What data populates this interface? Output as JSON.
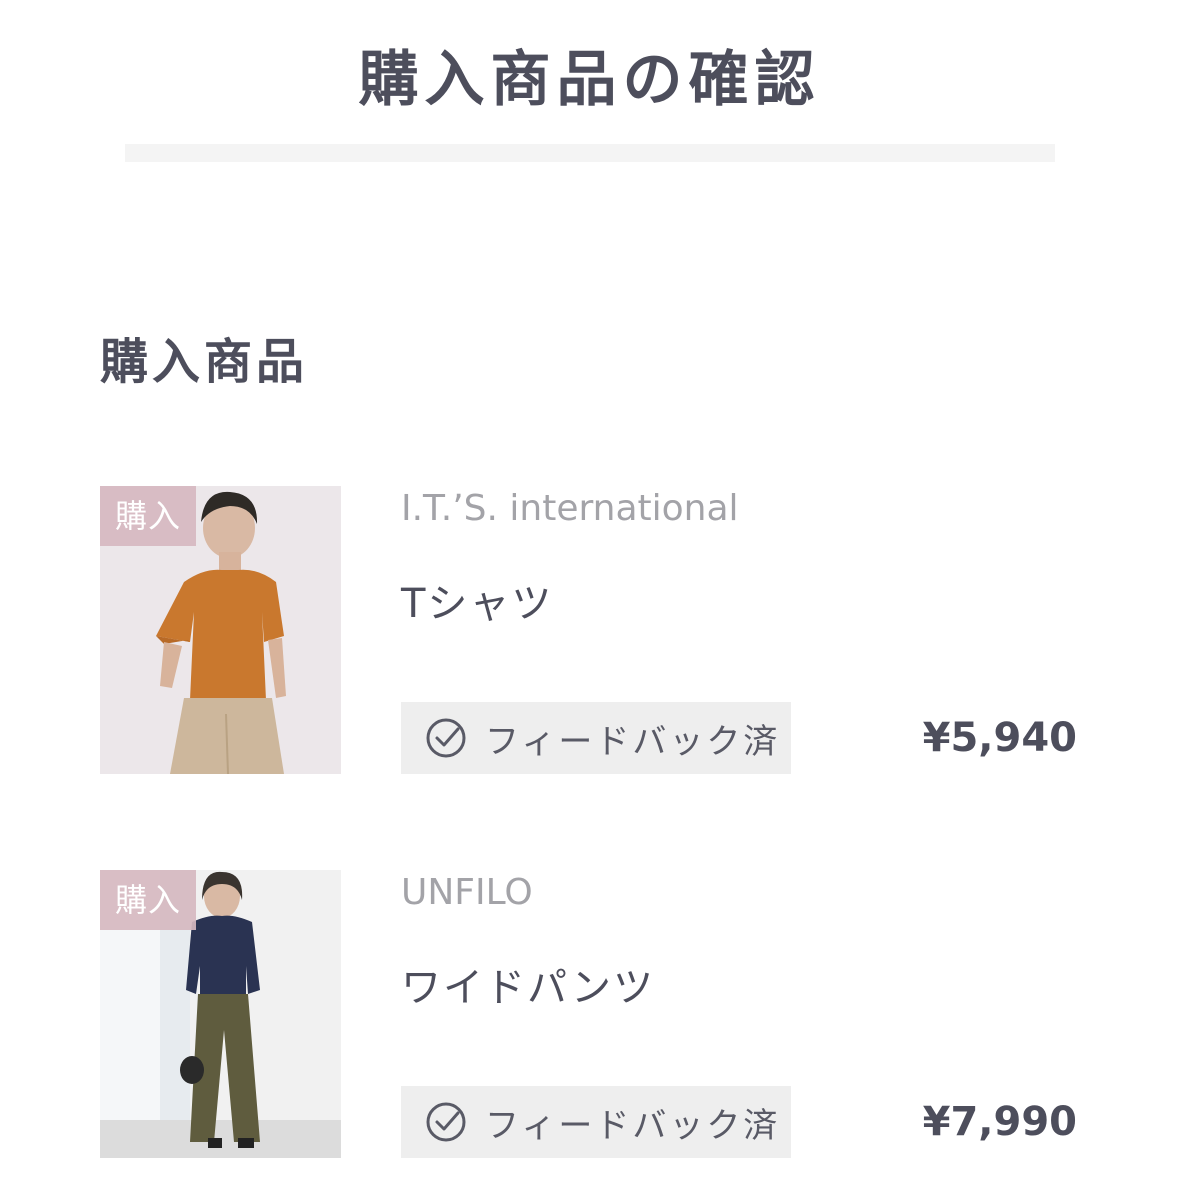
{
  "page": {
    "title": "購入商品の確認"
  },
  "section": {
    "title": "購入商品"
  },
  "products": [
    {
      "badge": "購入",
      "brand": "I.T.’S. international",
      "name": "Tシャツ",
      "feedback_label": "フィードバック済",
      "price": "¥5,940",
      "feedback_icon": "check-circle-icon"
    },
    {
      "badge": "購入",
      "brand": "UNFILO",
      "name": "ワイドパンツ",
      "feedback_label": "フィードバック済",
      "price": "¥7,990",
      "feedback_icon": "check-circle-icon"
    }
  ],
  "colors": {
    "text_dark": "#4d4e5c",
    "text_muted": "#a3a3a8",
    "badge_purchase": "#d6b8c0",
    "feedback_bg": "#eeeeee",
    "divider": "#f4f4f4"
  }
}
